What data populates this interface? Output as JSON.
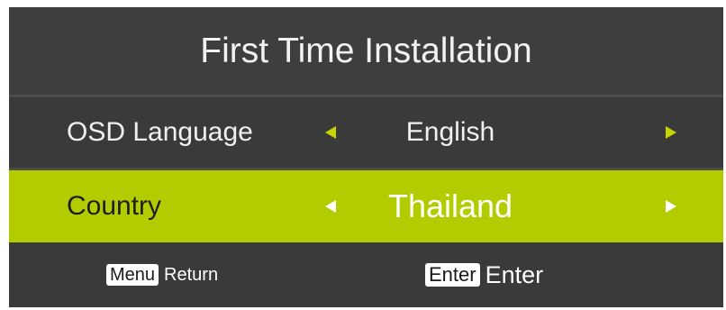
{
  "title": "First Time Installation",
  "rows": [
    {
      "label": "OSD Language",
      "value": "English",
      "selected": false
    },
    {
      "label": "Country",
      "value": "Thailand",
      "selected": true
    }
  ],
  "footer": {
    "return_key": "Menu",
    "return_label": "Return",
    "enter_key": "Enter",
    "enter_label": "Enter"
  },
  "colors": {
    "panel": "#3a3a3a",
    "highlight": "#b3cc00",
    "arrow": "#c8d400",
    "text": "#f0f0f0"
  },
  "icons": {
    "left": "triangle-left",
    "right": "triangle-right"
  }
}
